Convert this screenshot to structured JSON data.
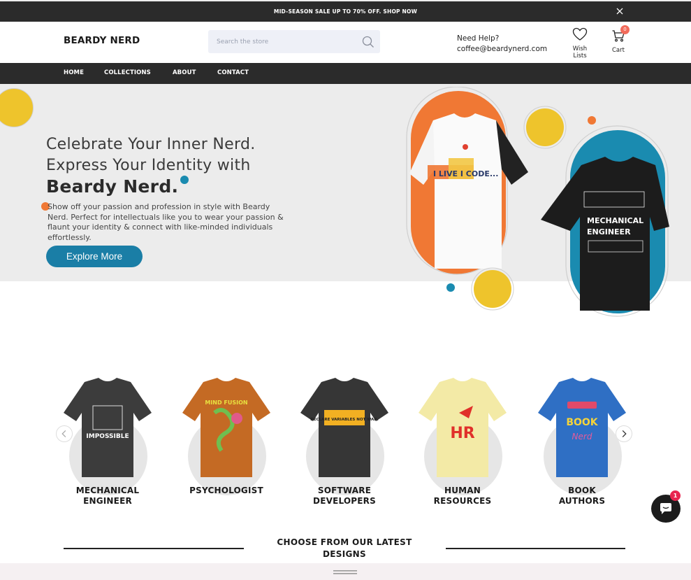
{
  "announcement": {
    "text": "MID-SEASON SALE UP TO 70% OFF. SHOP NOW"
  },
  "header": {
    "logo": "BEARDY NERD",
    "search_placeholder": "Search the store",
    "help_title": "Need Help?",
    "help_email": "coffee@beardynerd.com",
    "wish_label_1": "Wish",
    "wish_label_2": "Lists",
    "cart_label": "Cart",
    "cart_count": "0"
  },
  "nav": {
    "items": [
      "HOME",
      "COLLECTIONS",
      "ABOUT",
      "CONTACT"
    ]
  },
  "hero": {
    "title_line1": "Celebrate Your Inner Nerd.",
    "title_line2": "Express Your Identity with",
    "title_line3": "Beardy Nerd.",
    "description": "Show off your passion and profession in style with Beardy Nerd. Perfect for intellectuals like you to wear your passion & flaunt your identity & connect with like-minded  individuals effortlessly.",
    "button": "Explore More",
    "shirt1_text": "I LIVE I CODE...",
    "shirt2_text_1": "MECHANICAL",
    "shirt2_text_2": "ENGINEER"
  },
  "categories": [
    {
      "label1": "MECHANICAL",
      "label2": "ENGINEER",
      "shirt_color": "#3c3c3c",
      "print_text": "IMPOSSIBLE"
    },
    {
      "label1": "PSYCHOLOGIST",
      "label2": "",
      "shirt_color": "#c46a24",
      "print_text": "MIND FUSION"
    },
    {
      "label1": "SOFTWARE",
      "label2": "DEVELOPERS",
      "shirt_color": "#363636",
      "print_text": "DECLARE VARIABLES NOT WAR."
    },
    {
      "label1": "HUMAN",
      "label2": "RESOURCES",
      "shirt_color": "#f3eaa6",
      "print_text": "HR"
    },
    {
      "label1": "BOOK",
      "label2": "AUTHORS",
      "shirt_color": "#2f6fc4",
      "print_text": "BOOK"
    }
  ],
  "latest": {
    "title_line1": "CHOOSE FROM OUR LATEST",
    "title_line2": "DESIGNS"
  },
  "chat": {
    "badge": "1"
  },
  "colors": {
    "dark": "#2b2b2b",
    "accent_blue": "#1a7ea6",
    "yellow": "#eec42c",
    "orange": "#f07834",
    "teal": "#1a8bb0"
  }
}
